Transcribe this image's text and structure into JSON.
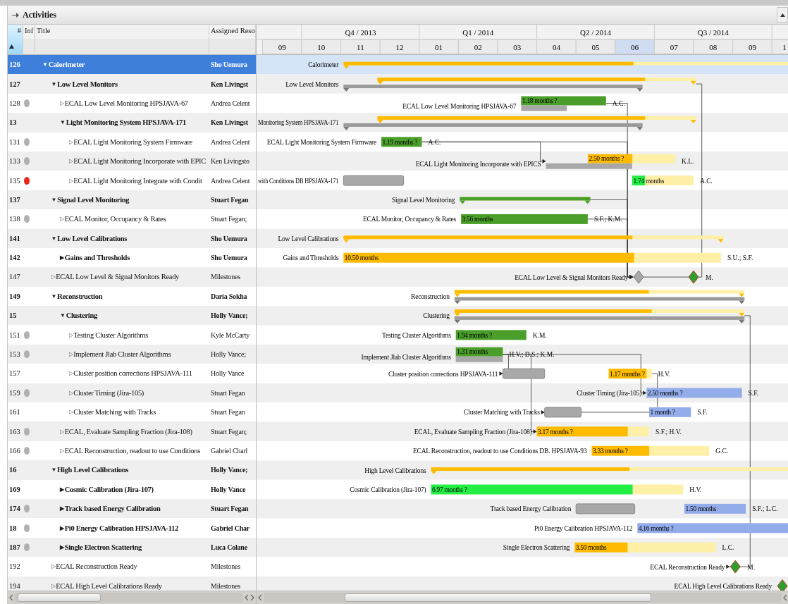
{
  "window": {
    "title": "Activities"
  },
  "columns": [
    "#",
    "Inf",
    "Title",
    "Assigned Reso"
  ],
  "timeline": {
    "quarters": [
      "Q4 / 2013",
      "Q1 / 2014",
      "Q2 / 2014",
      "Q3 / 2014"
    ],
    "months": [
      {
        "label": "09",
        "current": false
      },
      {
        "label": "10",
        "current": false
      },
      {
        "label": "11",
        "current": false
      },
      {
        "label": "12",
        "current": false
      },
      {
        "label": "01",
        "current": false
      },
      {
        "label": "02",
        "current": false
      },
      {
        "label": "03",
        "current": false
      },
      {
        "label": "04",
        "current": false
      },
      {
        "label": "05",
        "current": false
      },
      {
        "label": "06",
        "current": true
      },
      {
        "label": "07",
        "current": false
      },
      {
        "label": "08",
        "current": false
      },
      {
        "label": "09",
        "current": false
      },
      {
        "label": "1",
        "current": false
      }
    ]
  },
  "rows": [
    {
      "number": "126",
      "title": "Calorimeter",
      "toggle": "▼",
      "kind": "summary",
      "resource": "Sho Uemura",
      "selected": true,
      "gantt": {
        "label": "Calorimeter",
        "bars": [
          {
            "kind": "summary",
            "color": "#ffbb00"
          }
        ]
      },
      "children": [
        {
          "number": "127",
          "title": "Low Level Monitors",
          "toggle": "▼",
          "kind": "summary",
          "resource": "Ken Livingst",
          "selected": false,
          "gantt": {
            "label": "Low Level Monitors",
            "bars": [
              {
                "kind": "summary",
                "color": "#ffbb00",
                "level": 0.84
              },
              {
                "kind": "plan"
              }
            ]
          },
          "children": [
            {
              "number": "128",
              "info": {
                "color": "#b0b0b0"
              },
              "title": "ECAL Low Level Monitoring HPSJAVA-67",
              "toggle": "▷",
              "kind": "task",
              "resource": "Andrea Celent",
              "selected": false,
              "gantt": {
                "label": "ECAL Low Level Monitoring HPSJAVA-67",
                "bars": [
                  {
                    "kind": "task",
                    "color": "#4a9e2a",
                    "level": 1,
                    "text": "1.18 months ?"
                  },
                  {
                    "kind": "underlay"
                  }
                ],
                "resource": "A.C."
              }
            },
            {
              "number": "13",
              "title": "Light Monitoring System HPSJAVA-171",
              "toggle": "▼",
              "kind": "summary",
              "resource": "Ken Livingst",
              "selected": false,
              "gantt": {
                "label": "Monitoring System HPSJAVA-171",
                "bars": [
                  {
                    "kind": "summary",
                    "color": "#ffbb00",
                    "level": 0.84
                  },
                  {
                    "kind": "plan"
                  }
                ]
              },
              "children": [
                {
                  "number": "131",
                  "info": {
                    "color": "#b0b0b0"
                  },
                  "title": "ECAL Light Monitoring System Firmware",
                  "toggle": "▷",
                  "kind": "task",
                  "resource": "Andrea Celent",
                  "selected": false,
                  "gantt": {
                    "label": "ECAL Light Monitoring System Firmware",
                    "bars": [
                      {
                        "kind": "task",
                        "color": "#4a9e2a",
                        "level": 1,
                        "text": "1.19 months ?"
                      }
                    ],
                    "resource": "A.C."
                  }
                },
                {
                  "number": "133",
                  "info": {
                    "color": "#b0b0b0"
                  },
                  "title": "ECAL Light Monitoring Incorporate with EPIC",
                  "toggle": "▷",
                  "kind": "task",
                  "resource": "Ken Livingsto",
                  "selected": false,
                  "gantt": {
                    "label": "ECAL Light Monitoring Incorporate with EPICS",
                    "bars": [
                      {
                        "kind": "task",
                        "color": "#ffbb00",
                        "level": 0.51,
                        "text": "2.50 months ?"
                      },
                      {
                        "kind": "underlay"
                      }
                    ],
                    "resource": "K.L."
                  }
                },
                {
                  "number": "135",
                  "info": {
                    "color": "#e8271f"
                  },
                  "title": "ECAL Light Monitoring Integrate with Condit",
                  "toggle": "▷",
                  "kind": "task",
                  "resource": "Andrea Celent",
                  "selected": false,
                  "gantt": {
                    "label": "with Conditions DB HPSJAVA-171",
                    "bars": [
                      {
                        "kind": "baseline"
                      },
                      {
                        "kind": "task",
                        "color": "#22ee44",
                        "level": 0.21,
                        "text": "1.74 months"
                      }
                    ],
                    "resource": "A.C."
                  }
                }
              ]
            }
          ]
        },
        {
          "number": "137",
          "title": "Signal Level Monitoring",
          "toggle": "▼",
          "kind": "summary",
          "resource": "Stuart Fegan",
          "selected": false,
          "gantt": {
            "label": "Signal Level Monitoring",
            "bars": [
              {
                "kind": "summary",
                "color": "#4a9e2a",
                "level": 1
              }
            ]
          },
          "children": [
            {
              "number": "138",
              "info": {
                "color": "#b0b0b0"
              },
              "title": "ECAL Monitor, Occupancy & Rates",
              "toggle": "▷",
              "kind": "task",
              "resource": "Stuart Fegan;",
              "selected": false,
              "gantt": {
                "label": "ECAL Monitor, Occupancy & Rates",
                "bars": [
                  {
                    "kind": "task",
                    "color": "#4a9e2a",
                    "level": 1,
                    "text": "3.56 months"
                  }
                ],
                "resource": "S.F.; K.M."
              }
            }
          ]
        },
        {
          "number": "141",
          "title": "Low Level Calibrations",
          "toggle": "▼",
          "kind": "summary",
          "resource": "Sho Uemura",
          "selected": false,
          "gantt": {
            "label": "Low Level Calibrations",
            "bars": [
              {
                "kind": "summary",
                "color": "#ffbb00",
                "level": 0.76
              }
            ]
          },
          "children": [
            {
              "number": "142",
              "title": "Gains and Thresholds",
              "toggle": "▶",
              "kind": "summary",
              "resource": "Sho Uemura",
              "selected": false,
              "gantt": {
                "label": "Gains and Thresholds",
                "bars": [
                  {
                    "kind": "task",
                    "color": "#ffbb00",
                    "level": 0.77,
                    "text": "10.50 months"
                  }
                ],
                "resource": "S.U.; S.F."
              }
            }
          ]
        },
        {
          "number": "147",
          "title": "ECAL Low Level & Signal Monitors Ready",
          "toggle": "▷",
          "kind": "task",
          "resource": "Milestones",
          "selected": false,
          "gantt": {
            "label": "ECAL Low Level & Signal Monitors Ready",
            "bars": [
              {
                "kind": "baseline-milestone",
                "color": "#a8a8a8"
              },
              {
                "kind": "milestone",
                "color": "#2e9e2e"
              }
            ],
            "resource": "M."
          }
        },
        {
          "number": "149",
          "title": "Reconstruction",
          "toggle": "▼",
          "kind": "summary",
          "resource": "Daria Sokha",
          "selected": false,
          "gantt": {
            "label": "Reconstruction",
            "bars": [
              {
                "kind": "summary",
                "color": "#ffbb00",
                "level": 0.67
              },
              {
                "kind": "plan"
              }
            ]
          },
          "children": [
            {
              "number": "15",
              "title": "Clustering",
              "toggle": "▼",
              "kind": "summary",
              "resource": "Holly Vance;",
              "selected": false,
              "gantt": {
                "label": "Clustering",
                "bars": [
                  {
                    "kind": "summary",
                    "color": "#ffbb00",
                    "level": 0.68
                  },
                  {
                    "kind": "plan"
                  }
                ]
              },
              "children": [
                {
                  "number": "151",
                  "info": {
                    "color": "#b0b0b0"
                  },
                  "title": "Testing Cluster Algorithms",
                  "toggle": "▷",
                  "kind": "task",
                  "resource": "Kyle McCarty",
                  "selected": false,
                  "gantt": {
                    "label": "Testing Cluster Algorithms",
                    "bars": [
                      {
                        "kind": "task",
                        "color": "#4a9e2a",
                        "level": 1,
                        "text": "1.94 months ?"
                      }
                    ],
                    "resource": "K.M."
                  }
                },
                {
                  "number": "153",
                  "info": {
                    "color": "#b0b0b0"
                  },
                  "title": "Implement Jlab Cluster Algorithms",
                  "toggle": "▷",
                  "kind": "task",
                  "resource": "Holly Vance;",
                  "selected": false,
                  "gantt": {
                    "label": "Implement Jlab Cluster Algorithms",
                    "bars": [
                      {
                        "kind": "task",
                        "color": "#4a9e2a",
                        "level": 1,
                        "text": "1.31 months"
                      },
                      {
                        "kind": "underlay"
                      }
                    ],
                    "resource": "H.V.; D.S.; K.M."
                  }
                },
                {
                  "number": "157",
                  "title": "Cluster position corrections HPSJAVA-111",
                  "toggle": "▷",
                  "kind": "task",
                  "resource": "Holly Vance",
                  "selected": false,
                  "gantt": {
                    "label": "Cluster position corrections HPSJAVA-111",
                    "bars": [
                      {
                        "kind": "baseline"
                      },
                      {
                        "kind": "task",
                        "color": "#ffbb00",
                        "level": 0.88,
                        "text": "1.17 months ?"
                      }
                    ],
                    "resource": "H.V."
                  }
                },
                {
                  "number": "159",
                  "info": {
                    "color": "#b0b0b0"
                  },
                  "title": "Cluster Timing (Jira-105)",
                  "toggle": "▷",
                  "kind": "task",
                  "resource": "Stuart Fegan",
                  "selected": false,
                  "gantt": {
                    "label": "Cluster Timing (Jira-105)",
                    "bars": [
                      {
                        "kind": "task",
                        "color": "#93acea",
                        "level": 1,
                        "text": "2.50 months ?"
                      }
                    ],
                    "resource": "S.F."
                  }
                },
                {
                  "number": "161",
                  "title": "Cluster Matching with Tracks",
                  "toggle": "▷",
                  "kind": "task",
                  "resource": "Stuart Fegan",
                  "selected": false,
                  "gantt": {
                    "label": "Cluster Matching with Tracks",
                    "bars": [
                      {
                        "kind": "baseline"
                      },
                      {
                        "kind": "task",
                        "color": "#93acea",
                        "level": 1,
                        "text": "1 month ?"
                      }
                    ],
                    "resource": "S.F."
                  }
                }
              ]
            },
            {
              "number": "163",
              "info": {
                "color": "#b0b0b0"
              },
              "title": "ECAL, Evaluate Sampling Fraction (Jira-108)",
              "toggle": "▷",
              "kind": "task",
              "resource": "Stuart Fegan;",
              "selected": false,
              "gantt": {
                "label": "ECAL, Evaluate Sampling Fraction (Jira-108)",
                "bars": [
                  {
                    "kind": "task",
                    "color": "#ffbb00",
                    "level": 0.81,
                    "text": "3.17 months ?"
                  }
                ],
                "resource": "S.F.; H.V."
              }
            },
            {
              "number": "166",
              "info": {
                "color": "#b0b0b0"
              },
              "title": "ECAL Reconstruction, readout to use Conditions",
              "toggle": "▷",
              "kind": "task",
              "resource": "Gabriel Charl",
              "selected": false,
              "gantt": {
                "label": "ECAL Reconstruction, readout to use Conditions DB. HPSJAVA-93",
                "bars": [
                  {
                    "kind": "task",
                    "color": "#ffbb00",
                    "level": 0.49,
                    "text": "3.33 months ?"
                  }
                ],
                "resource": "G.C."
              }
            }
          ]
        },
        {
          "number": "16",
          "title": "High Level Calibrations",
          "toggle": "▼",
          "kind": "summary",
          "resource": "Holly Vance;",
          "selected": false,
          "gantt": {
            "label": "High Level Calibrations",
            "bars": [
              {
                "kind": "summary",
                "color": "#ffbb00"
              }
            ]
          },
          "children": [
            {
              "number": "169",
              "title": "Cosmic Calibration (Jira-107)",
              "toggle": "▶",
              "kind": "summary",
              "resource": "Holly Vance",
              "selected": false,
              "gantt": {
                "label": "Cosmic Calibration (Jira-107)",
                "bars": [
                  {
                    "kind": "task",
                    "color": "#22ee44",
                    "level": 0.8,
                    "text": "6.97 months ?"
                  }
                ],
                "resource": "H.V."
              }
            },
            {
              "number": "174",
              "info": {
                "color": "#b0b0b0"
              },
              "title": "Track based Energy Calibration",
              "toggle": "▶",
              "kind": "summary",
              "resource": "Stuart Fegan",
              "selected": false,
              "gantt": {
                "label": "Track based Energy Calibration",
                "bars": [
                  {
                    "kind": "baseline"
                  },
                  {
                    "kind": "task",
                    "color": "#93acea",
                    "level": 1,
                    "text": "1.50 months"
                  }
                ],
                "resource": "S.F.; L.C."
              }
            },
            {
              "number": "18",
              "info": {
                "color": "#b0b0b0"
              },
              "title": "Pi0 Energy Calibration HPSJAVA-112",
              "toggle": "▶",
              "kind": "summary",
              "resource": "Gabriel Char",
              "selected": false,
              "gantt": {
                "label": "Pi0 Energy Calibration HPSJAVA-112",
                "bars": [
                  {
                    "kind": "task",
                    "color": "#93acea",
                    "text": "4.16 months ?"
                  }
                ]
              }
            },
            {
              "number": "187",
              "info": {
                "color": "#b0b0b0"
              },
              "title": "Single Electron Scattering",
              "toggle": "▶",
              "kind": "summary",
              "resource": "Luca Colane",
              "selected": false,
              "gantt": {
                "label": "Single Electron Scattering",
                "bars": [
                  {
                    "kind": "task",
                    "color": "#ffbb00",
                    "level": 0.375,
                    "text": "3.50 months"
                  }
                ],
                "resource": "L.C."
              }
            }
          ]
        },
        {
          "number": "192",
          "title": "ECAL Reconstruction Ready",
          "toggle": "▷",
          "kind": "task",
          "resource": "Milestones",
          "selected": false,
          "gantt": {
            "label": "ECAL Reconstruction Ready",
            "bars": [
              {
                "kind": "milestone",
                "color": "#2e9e2e"
              }
            ],
            "resource": "M."
          }
        },
        {
          "number": "194",
          "title": "ECAL High Level Calibrations Ready",
          "toggle": "▷",
          "kind": "task",
          "resource": "Milestones",
          "selected": false,
          "gantt": {
            "label": "ECAL High Level Calibrations Ready",
            "bars": [
              {
                "kind": "milestone",
                "color": "#2e9e2e"
              }
            ]
          }
        }
      ]
    }
  ]
}
